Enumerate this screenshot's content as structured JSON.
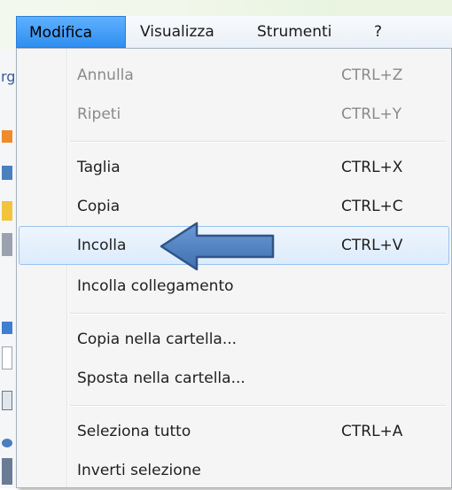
{
  "menubar": {
    "items": [
      {
        "label": "Modifica"
      },
      {
        "label": "Visualizza"
      },
      {
        "label": "Strumenti"
      },
      {
        "label": "?"
      }
    ]
  },
  "left_fragment": {
    "text": "rg"
  },
  "menu": {
    "items": [
      {
        "label": "Annulla",
        "shortcut": "CTRL+Z"
      },
      {
        "label": "Ripeti",
        "shortcut": "CTRL+Y"
      },
      {
        "label": "Taglia",
        "shortcut": "CTRL+X"
      },
      {
        "label": "Copia",
        "shortcut": "CTRL+C"
      },
      {
        "label": "Incolla",
        "shortcut": "CTRL+V"
      },
      {
        "label": "Incolla collegamento",
        "shortcut": ""
      },
      {
        "label": "Copia nella cartella...",
        "shortcut": ""
      },
      {
        "label": "Sposta nella cartella...",
        "shortcut": ""
      },
      {
        "label": "Seleziona tutto",
        "shortcut": "CTRL+A"
      },
      {
        "label": "Inverti selezione",
        "shortcut": ""
      }
    ]
  },
  "annotation": {
    "arrow_icon": "left-arrow-icon",
    "arrow_color": "#4f81bd"
  },
  "colors": {
    "menubar_active": "#3399ff",
    "highlight_border": "#99c3ee"
  }
}
